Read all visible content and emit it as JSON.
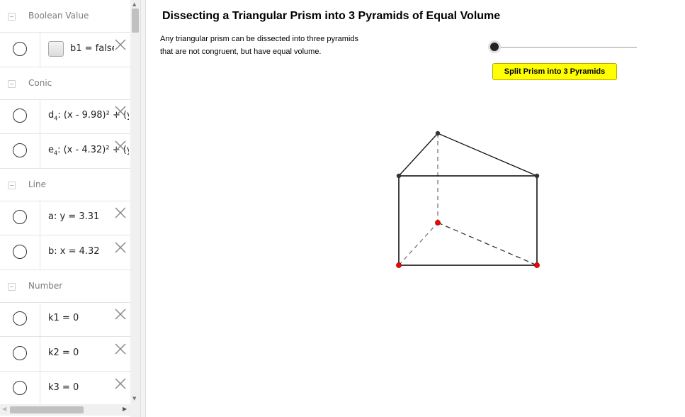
{
  "algebra_view": {
    "groups": [
      {
        "label": "Boolean Value",
        "items": [
          {
            "text": "b1 = false",
            "kind": "checkbox"
          }
        ]
      },
      {
        "label": "Conic",
        "items": [
          {
            "name": "d",
            "sub": "4",
            "rest": ": (x - 9.98)² + (y"
          },
          {
            "name": "e",
            "sub": "4",
            "rest": ": (x - 4.32)² + (y"
          }
        ]
      },
      {
        "label": "Line",
        "items": [
          {
            "text": "a: y = 3.31"
          },
          {
            "text": "b: x = 4.32"
          }
        ]
      },
      {
        "label": "Number",
        "items": [
          {
            "text": "k1 = 0"
          },
          {
            "text": "k2 = 0"
          },
          {
            "text": "k3 = 0"
          }
        ]
      }
    ]
  },
  "graphics_view": {
    "title": "Dissecting a Triangular Prism into 3 Pyramids of Equal Volume",
    "description_line1": "Any triangular prism can be dissected into three pyramids",
    "description_line2": "that are not congruent, but have equal volume.",
    "slider": {
      "value_fraction": 0
    },
    "split_button_label": "Split Prism into 3 Pyramids",
    "colors": {
      "button": "#ffff00",
      "bottom_points": "#ff0000",
      "top_points": "#333333"
    }
  },
  "icons": {
    "collapse": "collapse-minus-icon",
    "visibility": "visibility-circle-icon",
    "delete": "delete-x-icon"
  }
}
